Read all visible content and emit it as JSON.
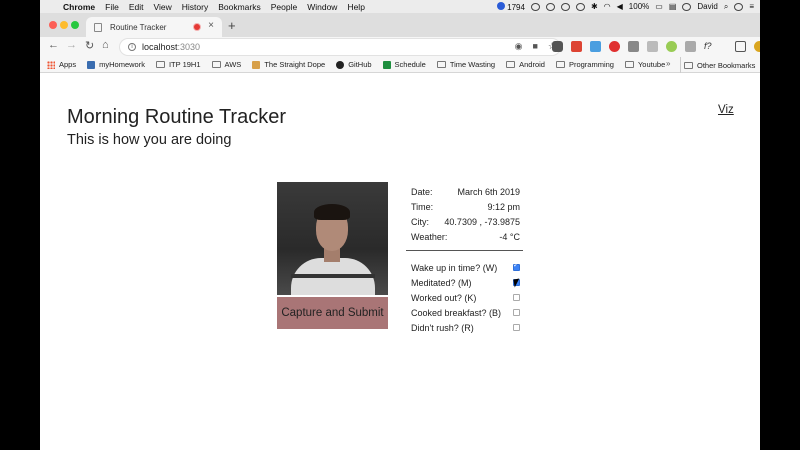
{
  "menubar": {
    "app_name": "Chrome",
    "items": [
      "File",
      "Edit",
      "View",
      "History",
      "Bookmarks",
      "People",
      "Window",
      "Help"
    ],
    "badge_count": "1794",
    "battery": "100%",
    "user": "David"
  },
  "browser": {
    "tab_title": "Routine Tracker",
    "url_host": "localhost",
    "url_port": ":3030"
  },
  "bookmarks": {
    "items": [
      "Apps",
      "myHomework",
      "ITP 19H1",
      "AWS",
      "The Straight Dope",
      "GitHub",
      "Schedule",
      "Time Wasting",
      "Android",
      "Programming",
      "Youtube"
    ],
    "other": "Other Bookmarks",
    "more": "»"
  },
  "page": {
    "title": "Morning Routine Tracker",
    "subtitle": "This is how you are doing",
    "viz_link": "Viz",
    "capture_button": "Capture and Submit",
    "info": [
      {
        "label": "Date:",
        "value": "March 6th 2019"
      },
      {
        "label": "Time:",
        "value": "9:12 pm"
      },
      {
        "label": "City:",
        "value": "40.7309 , -73.9875"
      },
      {
        "label": "Weather:",
        "value": "-4 °C"
      }
    ],
    "checklist": [
      {
        "label": "Wake up in time? (W)",
        "checked": true
      },
      {
        "label": "Meditated? (M)",
        "checked": true
      },
      {
        "label": "Worked out? (K)",
        "checked": false
      },
      {
        "label": "Cooked breakfast? (B)",
        "checked": false
      },
      {
        "label": "Didn't rush? (R)",
        "checked": false
      }
    ]
  },
  "colors": {
    "capture_button": "#a97576",
    "checkbox_checked": "#3b82f6"
  }
}
